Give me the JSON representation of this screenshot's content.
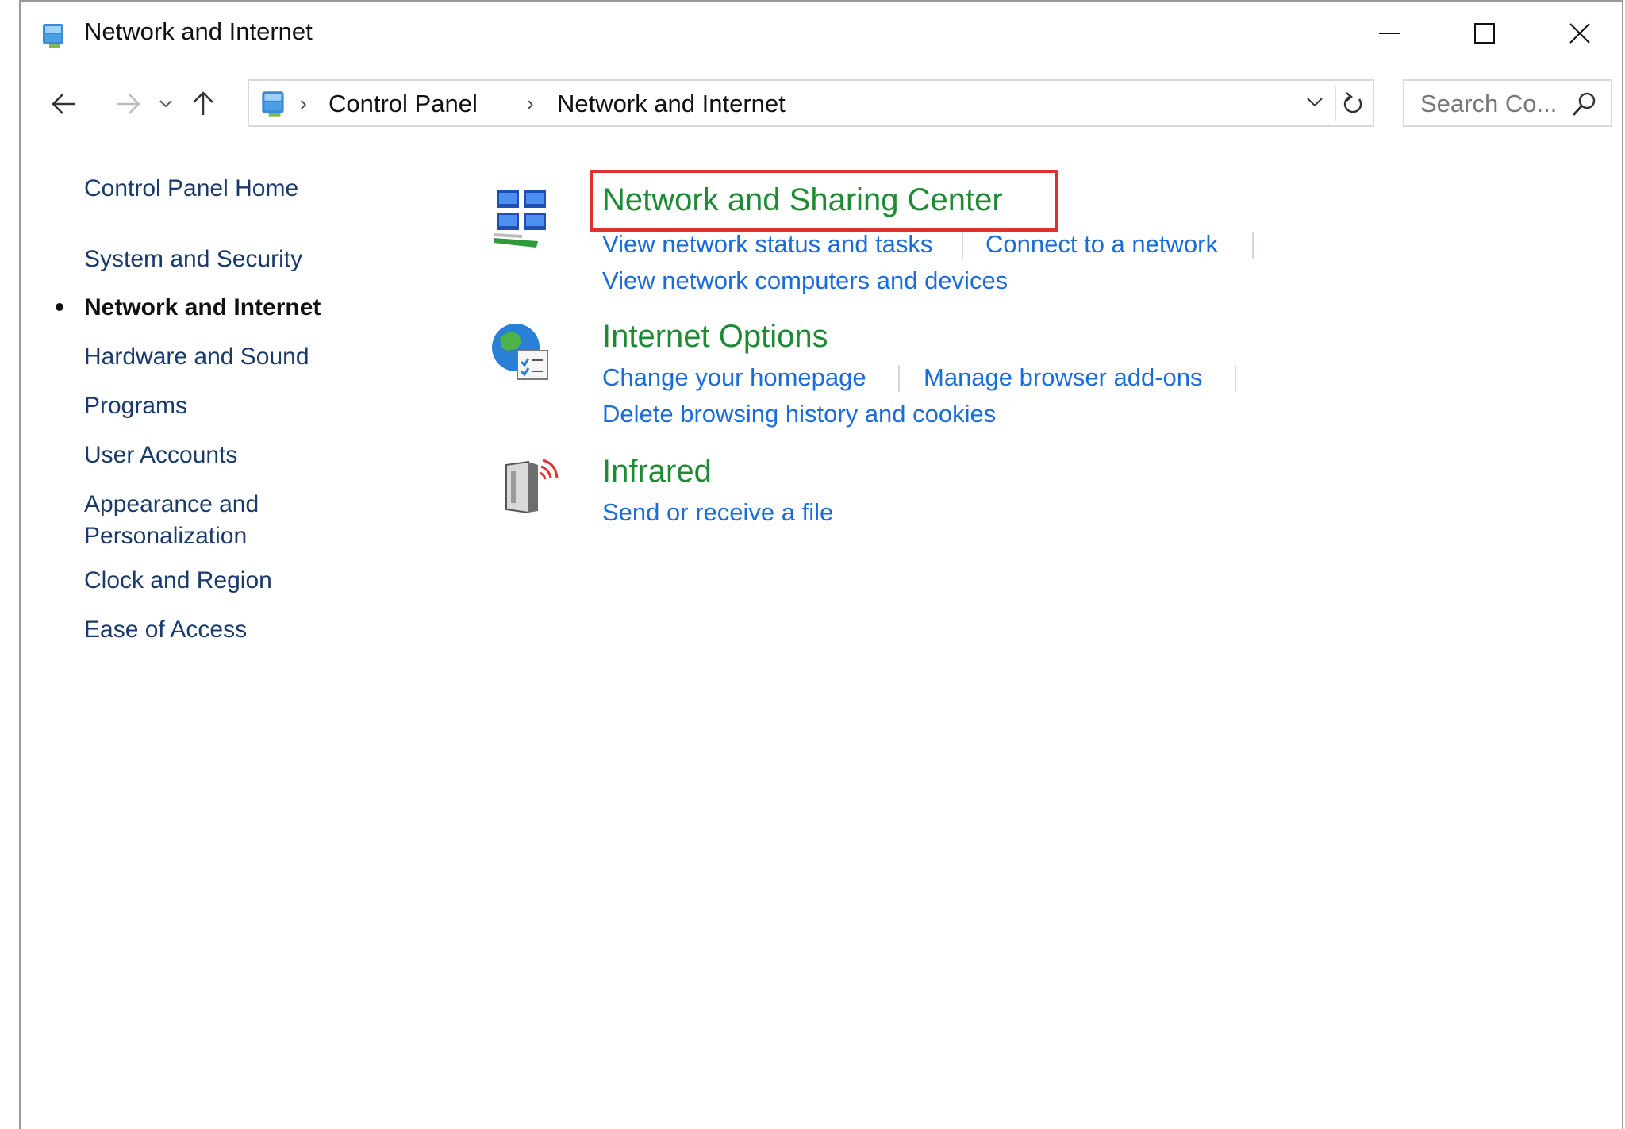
{
  "window": {
    "title": "Network and Internet",
    "controls": {
      "minimize": "minimize",
      "maximize": "maximize",
      "close": "close"
    }
  },
  "nav": {
    "breadcrumb": [
      "Control Panel",
      "Network and Internet"
    ],
    "search_placeholder": "Search Co..."
  },
  "sidebar": {
    "items": [
      {
        "label": "Control Panel Home",
        "active": false
      },
      {
        "label": "System and Security",
        "active": false
      },
      {
        "label": "Network and Internet",
        "active": true
      },
      {
        "label": "Hardware and Sound",
        "active": false
      },
      {
        "label": "Programs",
        "active": false
      },
      {
        "label": "User Accounts",
        "active": false
      },
      {
        "label": "Appearance and",
        "label_line2": "Personalization",
        "active": false
      },
      {
        "label": "Clock and Region",
        "active": false
      },
      {
        "label": "Ease of Access",
        "active": false
      }
    ]
  },
  "categories": [
    {
      "title": "Network and Sharing Center",
      "icon": "network-sharing-icon",
      "highlighted": true,
      "links": [
        "View network status and tasks",
        "Connect to a network",
        "View network computers and devices"
      ]
    },
    {
      "title": "Internet Options",
      "icon": "internet-options-icon",
      "highlighted": false,
      "links": [
        "Change your homepage",
        "Manage browser add-ons",
        "Delete browsing history and cookies"
      ]
    },
    {
      "title": "Infrared",
      "icon": "infrared-icon",
      "highlighted": false,
      "links": [
        "Send or receive a file"
      ]
    }
  ],
  "colors": {
    "category_title": "#1e8a33",
    "link": "#1a6cd8",
    "sidebar_link": "#1a3a6b",
    "highlight": "#e03030"
  }
}
